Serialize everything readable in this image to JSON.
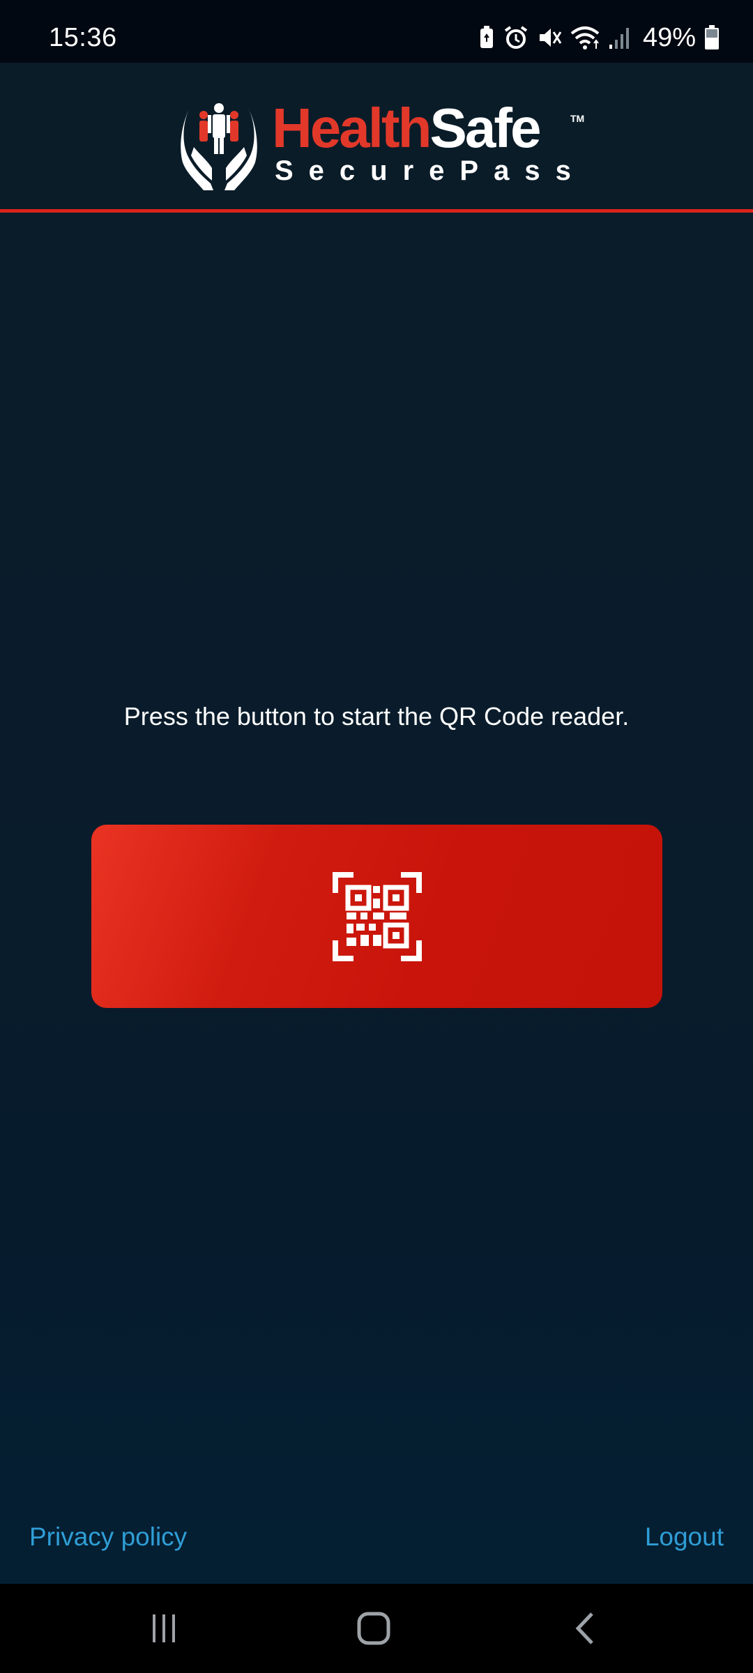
{
  "status_bar": {
    "time": "15:36",
    "battery_percent": "49%",
    "icons": [
      "battery-saver-icon",
      "alarm-icon",
      "mute-icon",
      "wifi-icon",
      "signal-icon",
      "battery-icon"
    ]
  },
  "header": {
    "brand_health": "Health",
    "brand_safe": "Safe",
    "trademark": "TM",
    "subtitle": "SecurePass",
    "logo_icon": "hands-people-logo-icon",
    "accent_color": "#d9231b"
  },
  "main": {
    "prompt": "Press the button to start the QR Code reader.",
    "scan_button_icon": "qr-code-scan-icon",
    "button_color": "#c8140a"
  },
  "footer": {
    "privacy_label": "Privacy policy",
    "logout_label": "Logout",
    "link_color": "#2f9ed6"
  },
  "nav_bar": {
    "buttons": [
      "recents-icon",
      "home-icon",
      "back-icon"
    ]
  }
}
